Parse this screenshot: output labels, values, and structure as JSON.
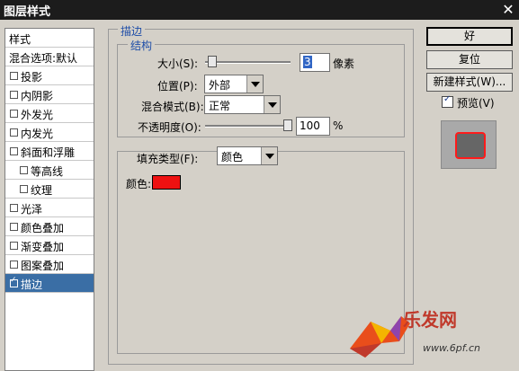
{
  "window": {
    "title": "图层样式",
    "close_label": "✕"
  },
  "sidebar": {
    "items": [
      {
        "label": "样式",
        "has_checkbox": false,
        "indent": false,
        "checked": false,
        "active": false
      },
      {
        "label": "混合选项:默认",
        "has_checkbox": false,
        "indent": false,
        "checked": false,
        "active": false
      },
      {
        "label": "投影",
        "has_checkbox": true,
        "indent": false,
        "checked": false,
        "active": false
      },
      {
        "label": "内阴影",
        "has_checkbox": true,
        "indent": false,
        "checked": false,
        "active": false
      },
      {
        "label": "外发光",
        "has_checkbox": true,
        "indent": false,
        "checked": false,
        "active": false
      },
      {
        "label": "内发光",
        "has_checkbox": true,
        "indent": false,
        "checked": false,
        "active": false
      },
      {
        "label": "斜面和浮雕",
        "has_checkbox": true,
        "indent": false,
        "checked": false,
        "active": false
      },
      {
        "label": "等高线",
        "has_checkbox": true,
        "indent": true,
        "checked": false,
        "active": false
      },
      {
        "label": "纹理",
        "has_checkbox": true,
        "indent": true,
        "checked": false,
        "active": false
      },
      {
        "label": "光泽",
        "has_checkbox": true,
        "indent": false,
        "checked": false,
        "active": false
      },
      {
        "label": "颜色叠加",
        "has_checkbox": true,
        "indent": false,
        "checked": false,
        "active": false
      },
      {
        "label": "渐变叠加",
        "has_checkbox": true,
        "indent": false,
        "checked": false,
        "active": false
      },
      {
        "label": "图案叠加",
        "has_checkbox": true,
        "indent": false,
        "checked": false,
        "active": false
      },
      {
        "label": "描边",
        "has_checkbox": true,
        "indent": false,
        "checked": true,
        "active": true
      }
    ]
  },
  "stroke": {
    "section_title": "描边",
    "structure_title": "结构",
    "size_label": "大小(S):",
    "size_value": "3",
    "size_unit": "像素",
    "size_slider_fraction": 0.03,
    "position_label": "位置(P):",
    "position_value": "外部",
    "blend_label": "混合模式(B):",
    "blend_value": "正常",
    "opacity_label": "不透明度(O):",
    "opacity_value": "100",
    "opacity_unit": "%",
    "opacity_slider_fraction": 1.0,
    "fill_type_label": "填充类型(F):",
    "fill_type_value": "颜色",
    "color_label": "颜色:",
    "color_value": "#ee1111"
  },
  "buttons": {
    "ok": "好",
    "reset": "复位",
    "new_style": "新建样式(W)...",
    "preview_label": "预览(V)",
    "preview_checked": true
  },
  "watermark": {
    "text": "乐发网",
    "url": "www.6pf.cn"
  }
}
